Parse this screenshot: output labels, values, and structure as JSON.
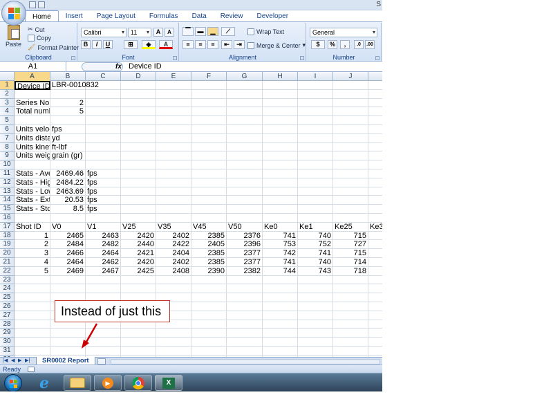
{
  "title_fragment": "S",
  "ribbon": {
    "tabs": [
      "Home",
      "Insert",
      "Page Layout",
      "Formulas",
      "Data",
      "Review",
      "Developer"
    ],
    "active_tab": "Home",
    "clipboard": {
      "paste": "Paste",
      "cut": "Cut",
      "copy": "Copy",
      "format_painter": "Format Painter",
      "label": "Clipboard"
    },
    "font": {
      "name": "Calibri",
      "size": "11",
      "grow": "A",
      "shrink": "A",
      "bold": "B",
      "italic": "I",
      "underline": "U",
      "font_color": "A",
      "label": "Font"
    },
    "alignment": {
      "wrap_text": "Wrap Text",
      "merge_center": "Merge & Center",
      "label": "Alignment"
    },
    "number": {
      "format": "General",
      "currency": "$",
      "percent": "%",
      "comma": ",",
      "label": "Number"
    }
  },
  "formula_bar": {
    "name_box": "A1",
    "fx": "fx",
    "value": "Device ID"
  },
  "columns": [
    "A",
    "B",
    "C",
    "D",
    "E",
    "F",
    "G",
    "H",
    "I",
    "J"
  ],
  "rows": [
    {
      "n": "1",
      "cells": [
        "Device ID",
        "LBR-0010832",
        "",
        "",
        "",
        "",
        "",
        "",
        "",
        "",
        ""
      ]
    },
    {
      "n": "2",
      "cells": [
        "",
        "",
        "",
        "",
        "",
        "",
        "",
        "",
        "",
        "",
        ""
      ]
    },
    {
      "n": "3",
      "cells": [
        "Series No",
        "2",
        "",
        "",
        "",
        "",
        "",
        "",
        "",
        "",
        ""
      ]
    },
    {
      "n": "4",
      "cells": [
        "Total numb",
        "5",
        "",
        "",
        "",
        "",
        "",
        "",
        "",
        "",
        ""
      ]
    },
    {
      "n": "5",
      "cells": [
        "",
        "",
        "",
        "",
        "",
        "",
        "",
        "",
        "",
        "",
        ""
      ]
    },
    {
      "n": "6",
      "cells": [
        "Units veloc",
        "fps",
        "",
        "",
        "",
        "",
        "",
        "",
        "",
        "",
        ""
      ]
    },
    {
      "n": "7",
      "cells": [
        "Units dista",
        "yd",
        "",
        "",
        "",
        "",
        "",
        "",
        "",
        "",
        ""
      ]
    },
    {
      "n": "8",
      "cells": [
        "Units kinet",
        "ft-lbf",
        "",
        "",
        "",
        "",
        "",
        "",
        "",
        "",
        ""
      ]
    },
    {
      "n": "9",
      "cells": [
        "Units weig",
        "grain (gr)",
        "",
        "",
        "",
        "",
        "",
        "",
        "",
        "",
        ""
      ]
    },
    {
      "n": "10",
      "cells": [
        "",
        "",
        "",
        "",
        "",
        "",
        "",
        "",
        "",
        "",
        ""
      ]
    },
    {
      "n": "11",
      "cells": [
        "Stats - Ave",
        "2469.46",
        "fps",
        "",
        "",
        "",
        "",
        "",
        "",
        "",
        ""
      ]
    },
    {
      "n": "12",
      "cells": [
        "Stats - High",
        "2484.22",
        "fps",
        "",
        "",
        "",
        "",
        "",
        "",
        "",
        ""
      ]
    },
    {
      "n": "13",
      "cells": [
        "Stats - Low",
        "2463.69",
        "fps",
        "",
        "",
        "",
        "",
        "",
        "",
        "",
        ""
      ]
    },
    {
      "n": "14",
      "cells": [
        "Stats - Ext.",
        "20.53",
        "fps",
        "",
        "",
        "",
        "",
        "",
        "",
        "",
        ""
      ]
    },
    {
      "n": "15",
      "cells": [
        "Stats - Std.",
        "8.5",
        "fps",
        "",
        "",
        "",
        "",
        "",
        "",
        "",
        ""
      ]
    },
    {
      "n": "16",
      "cells": [
        "",
        "",
        "",
        "",
        "",
        "",
        "",
        "",
        "",
        "",
        ""
      ]
    },
    {
      "n": "17",
      "cells": [
        "Shot ID",
        "V0",
        "V1",
        "V25",
        "V35",
        "V45",
        "V50",
        "Ke0",
        "Ke1",
        "Ke25",
        "Ke3"
      ]
    },
    {
      "n": "18",
      "cells": [
        "1",
        "2465",
        "2463",
        "2420",
        "2402",
        "2385",
        "2376",
        "741",
        "740",
        "715",
        ""
      ]
    },
    {
      "n": "19",
      "cells": [
        "2",
        "2484",
        "2482",
        "2440",
        "2422",
        "2405",
        "2396",
        "753",
        "752",
        "727",
        ""
      ]
    },
    {
      "n": "20",
      "cells": [
        "3",
        "2466",
        "2464",
        "2421",
        "2404",
        "2385",
        "2377",
        "742",
        "741",
        "715",
        ""
      ]
    },
    {
      "n": "21",
      "cells": [
        "4",
        "2464",
        "2462",
        "2420",
        "2402",
        "2385",
        "2377",
        "741",
        "740",
        "714",
        ""
      ]
    },
    {
      "n": "22",
      "cells": [
        "5",
        "2469",
        "2467",
        "2425",
        "2408",
        "2390",
        "2382",
        "744",
        "743",
        "718",
        ""
      ]
    },
    {
      "n": "23",
      "cells": [
        "",
        "",
        "",
        "",
        "",
        "",
        "",
        "",
        "",
        "",
        ""
      ]
    },
    {
      "n": "24",
      "cells": [
        "",
        "",
        "",
        "",
        "",
        "",
        "",
        "",
        "",
        "",
        ""
      ]
    },
    {
      "n": "25",
      "cells": [
        "",
        "",
        "",
        "",
        "",
        "",
        "",
        "",
        "",
        "",
        ""
      ]
    },
    {
      "n": "26",
      "cells": [
        "",
        "",
        "",
        "",
        "",
        "",
        "",
        "",
        "",
        "",
        ""
      ]
    },
    {
      "n": "27",
      "cells": [
        "",
        "",
        "",
        "",
        "",
        "",
        "",
        "",
        "",
        "",
        ""
      ]
    },
    {
      "n": "28",
      "cells": [
        "",
        "",
        "",
        "",
        "",
        "",
        "",
        "",
        "",
        "",
        ""
      ]
    },
    {
      "n": "29",
      "cells": [
        "",
        "",
        "",
        "",
        "",
        "",
        "",
        "",
        "",
        "",
        ""
      ]
    },
    {
      "n": "30",
      "cells": [
        "",
        "",
        "",
        "",
        "",
        "",
        "",
        "",
        "",
        "",
        ""
      ]
    },
    {
      "n": "31",
      "cells": [
        "",
        "",
        "",
        "",
        "",
        "",
        "",
        "",
        "",
        "",
        ""
      ]
    },
    {
      "n": "32",
      "cells": [
        "",
        "",
        "",
        "",
        "",
        "",
        "",
        "",
        "",
        "",
        ""
      ]
    }
  ],
  "sheet_tab": "SR0002 Report",
  "status": "Ready",
  "annotation": "Instead of just this",
  "colors": {
    "annotation_border": "#c0392b",
    "arrow": "#cc0000",
    "selected_header": "#f8d88a",
    "ribbon": "#d3e2f5"
  },
  "taskbar": {
    "items": [
      "start-orb",
      "internet-explorer-icon",
      "file-explorer-icon",
      "media-player-icon",
      "chrome-icon",
      "excel-icon"
    ]
  }
}
